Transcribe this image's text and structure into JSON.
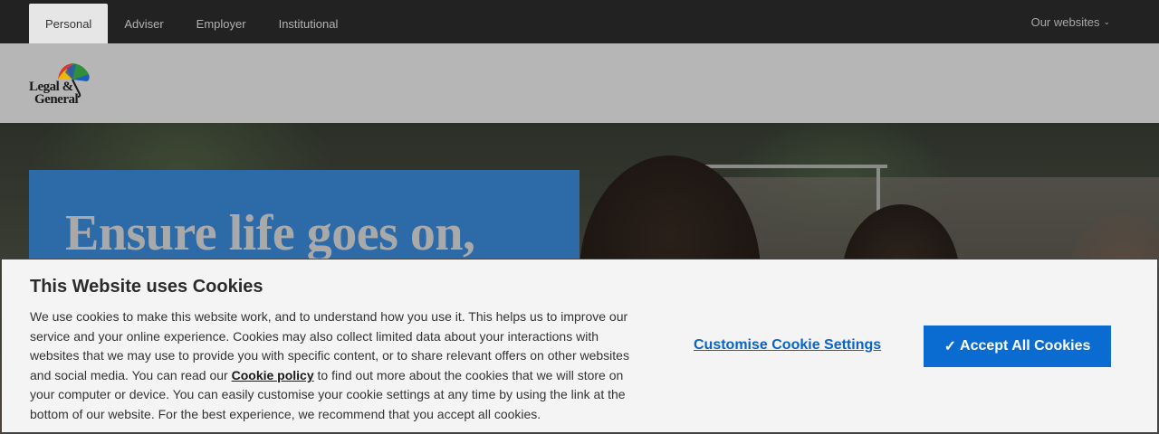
{
  "topbar": {
    "tabs": [
      {
        "label": "Personal",
        "active": true
      },
      {
        "label": "Adviser",
        "active": false
      },
      {
        "label": "Employer",
        "active": false
      },
      {
        "label": "Institutional",
        "active": false
      }
    ],
    "websites_label": "Our websites",
    "websites_icon": "chevron-down-icon"
  },
  "header": {
    "logo_line1": "Legal &",
    "logo_line2": "General",
    "logo_icon": "umbrella-icon"
  },
  "hero": {
    "headline": "Ensure life goes on,"
  },
  "cookie": {
    "title": "This Website uses Cookies",
    "body_before": "We use cookies to make this website work, and to understand how you use it. This helps us to improve our service and your online experience. Cookies may also collect limited data about your interactions with websites that we may use to provide you with specific content, or to share relevant offers on other websites and social media. You can read our ",
    "policy_link": "Cookie policy",
    "body_after": " to find out more about the cookies that we will store on your computer or device. You can easily customise your cookie settings at any time by using the link at the bottom of our website. For the best experience, we recommend that you accept all cookies.",
    "customise_label": "Customise Cookie Settings",
    "accept_tick": "✓",
    "accept_label": "Accept All Cookies"
  },
  "colors": {
    "topbar_bg": "#222222",
    "promo_bg": "#2d6aa8",
    "accept_bg": "#0a6bd1",
    "link": "#0a63c9"
  }
}
